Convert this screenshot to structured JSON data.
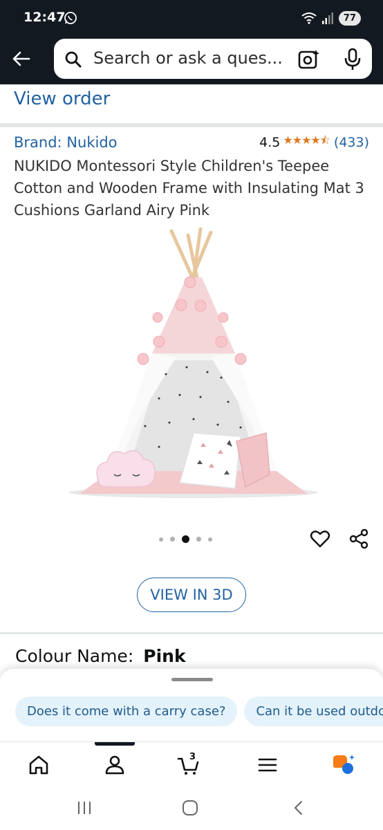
{
  "status": {
    "time": "12:47",
    "battery": "77"
  },
  "search": {
    "placeholder": "Search or ask a ques..."
  },
  "links": {
    "view_order": "View order"
  },
  "product": {
    "brand": "Brand: Nukido",
    "rating": "4.5",
    "stars": "★★★★⯪",
    "review_count": "(433)",
    "title": "NUKIDO Montessori Style Children's Teepee Cotton and Wooden Frame with Insulating Mat 3 Cushions Garland Airy Pink",
    "image_count": 5,
    "active_image": 3
  },
  "buttons": {
    "view_3d": "VIEW IN 3D"
  },
  "colour": {
    "label": "Colour Name:",
    "value": "Pink"
  },
  "suggestions": [
    "Does it come with a carry case?",
    "Can it be used outdoors?"
  ],
  "bottom_nav": {
    "cart_count": "3"
  },
  "colors": {
    "header": "#131921",
    "link": "#2162a1",
    "star": "#de7921",
    "chip_bg": "#e4f2fb"
  }
}
